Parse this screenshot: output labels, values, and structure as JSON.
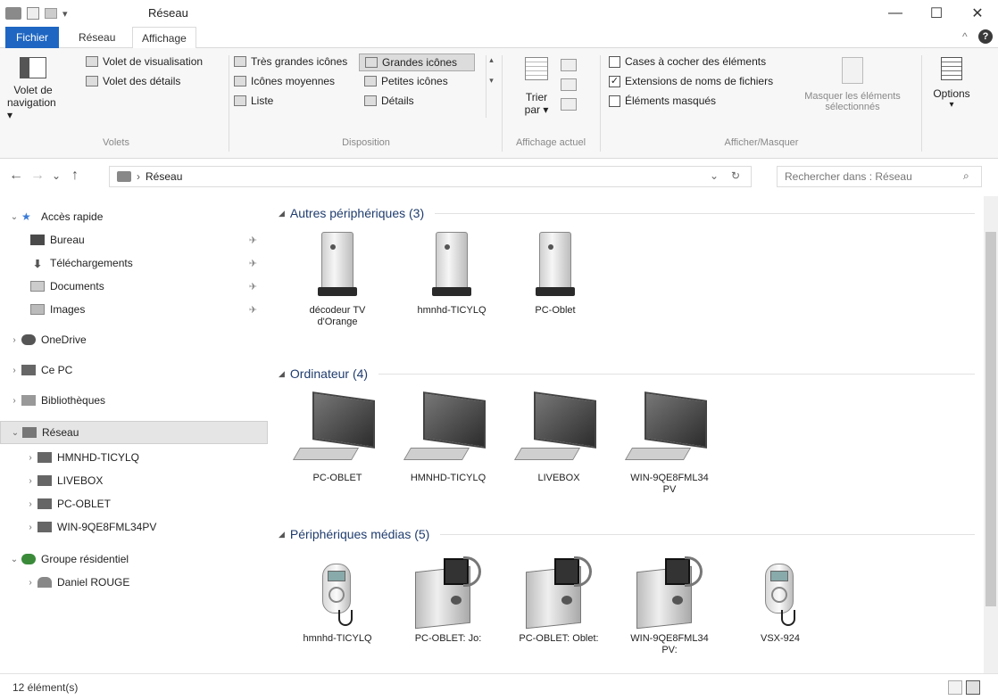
{
  "window": {
    "title": "Réseau",
    "qat_dropdown": "▾",
    "minimize": "—",
    "maximize": "☐",
    "close": "✕"
  },
  "ribbon_tabs": [
    "Fichier",
    "Réseau",
    "Affichage"
  ],
  "ribbon_collapse": "^",
  "ribbon_help": "?",
  "ribbon": {
    "volets": {
      "nav_pane_line1": "Volet de",
      "nav_pane_line2": "navigation ▾",
      "preview": "Volet de visualisation",
      "details": "Volet des détails",
      "group": "Volets"
    },
    "disposition": {
      "items": [
        "Très grandes icônes",
        "Grandes icônes",
        "Icônes moyennes",
        "Petites icônes",
        "Liste",
        "Détails"
      ],
      "scroll_up": "▴",
      "scroll_more": "▾",
      "group": "Disposition"
    },
    "affichage_actuel": {
      "sort_line1": "Trier",
      "sort_line2": "par ▾",
      "group": "Affichage actuel"
    },
    "afficher_masquer": {
      "checkboxes": [
        {
          "label": "Cases à cocher des éléments",
          "checked": false
        },
        {
          "label": "Extensions de noms de fichiers",
          "checked": true
        },
        {
          "label": "Éléments masqués",
          "checked": false
        }
      ],
      "hide_selected_line1": "Masquer les éléments",
      "hide_selected_line2": "sélectionnés",
      "group": "Afficher/Masquer"
    },
    "options": {
      "label": "Options",
      "arrow": "▾"
    }
  },
  "address": {
    "back": "←",
    "forward": "→",
    "recent": "⌄",
    "up": "↑",
    "separator": "›",
    "path": "Réseau",
    "dropdown": "⌄",
    "refresh": "↻",
    "search_placeholder": "Rechercher dans : Réseau",
    "search_glyph": "⌕"
  },
  "nav": {
    "expanded_caret": "⌄",
    "collapsed_caret": "›",
    "pin": "✈",
    "quick_access": "Accès rapide",
    "quick_items": [
      "Bureau",
      "Téléchargements",
      "Documents",
      "Images"
    ],
    "onedrive": "OneDrive",
    "this_pc": "Ce PC",
    "libraries": "Bibliothèques",
    "network": "Réseau",
    "network_children": [
      "HMNHD-TICYLQ",
      "LIVEBOX",
      "PC-OBLET",
      "WIN-9QE8FML34PV"
    ],
    "homegroup": "Groupe résidentiel",
    "homegroup_children": [
      "Daniel ROUGE"
    ]
  },
  "content": {
    "group_toggle": "◢",
    "groups": [
      {
        "title": "Autres périphériques (3)",
        "items": [
          "décodeur TV d'Orange",
          "hmnhd-TICYLQ",
          "PC-Oblet"
        ]
      },
      {
        "title": "Ordinateur (4)",
        "items": [
          "PC-OBLET",
          "HMNHD-TICYLQ",
          "LIVEBOX",
          "WIN-9QE8FML34 PV"
        ]
      },
      {
        "title": "Périphériques médias (5)",
        "items": [
          "hmnhd-TICYLQ",
          "PC-OBLET: Jo:",
          "PC-OBLET: Oblet:",
          "WIN-9QE8FML34 PV:",
          "VSX-924"
        ]
      }
    ]
  },
  "status": {
    "count": "12 élément(s)"
  }
}
